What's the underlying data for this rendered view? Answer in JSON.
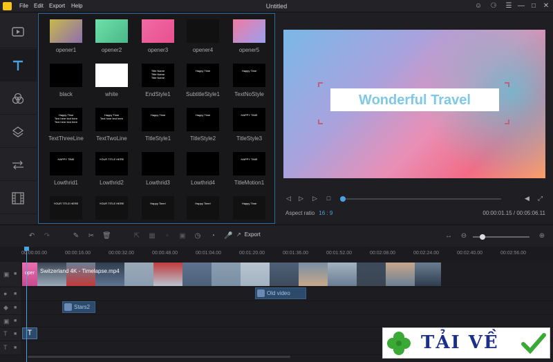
{
  "window": {
    "title": "Untitled",
    "menus": [
      "File",
      "Edit",
      "Export",
      "Help"
    ]
  },
  "nav": [
    "media-icon",
    "text-icon",
    "filter-icon",
    "overlay-icon",
    "transition-icon",
    "film-icon"
  ],
  "titles": [
    {
      "label": "opener1",
      "thumb_text": ""
    },
    {
      "label": "opener2",
      "thumb_text": ""
    },
    {
      "label": "opener3",
      "thumb_text": ""
    },
    {
      "label": "opener4",
      "thumb_text": ""
    },
    {
      "label": "opener5",
      "thumb_text": ""
    },
    {
      "label": "black",
      "thumb_text": ""
    },
    {
      "label": "white",
      "thumb_text": ""
    },
    {
      "label": "EndStyle1",
      "thumb_text": "Title Name\nTitle Name\nTitle Name"
    },
    {
      "label": "SubtitleStyle1",
      "thumb_text": "Happy Time"
    },
    {
      "label": "TextNoStyle",
      "thumb_text": "Happy Time"
    },
    {
      "label": "TextThreeLine",
      "thumb_text": "Happy Time\nText here text here\nText here text here"
    },
    {
      "label": "TextTwoLine",
      "thumb_text": "Happy Time\nText here text here"
    },
    {
      "label": "TitleStyle1",
      "thumb_text": "Happy Time"
    },
    {
      "label": "TitleStyle2",
      "thumb_text": "Happy Time"
    },
    {
      "label": "TitleStyle3",
      "thumb_text": "HAPPY TIME"
    },
    {
      "label": "Lowthrid1",
      "thumb_text": "HAPPY TIME"
    },
    {
      "label": "Lowthrid2",
      "thumb_text": "YOUR TITLE HERE"
    },
    {
      "label": "Lowthrid3",
      "thumb_text": ""
    },
    {
      "label": "Lowthrid4",
      "thumb_text": ""
    },
    {
      "label": "TitleMotion1",
      "thumb_text": "HAPPY TIME"
    },
    {
      "label": "",
      "thumb_text": "YOUR TITLE HERE"
    },
    {
      "label": "",
      "thumb_text": "YOUR TITLE HERE"
    },
    {
      "label": "",
      "thumb_text": "Happy Time!"
    },
    {
      "label": "",
      "thumb_text": "Happy Time!"
    },
    {
      "label": "",
      "thumb_text": "Happy Time"
    }
  ],
  "preview": {
    "title_text": "Wonderful Travel",
    "aspect_label": "Aspect ratio",
    "aspect_value": "16 : 9",
    "timecode": "00:00:01.15 / 00:05:06.11",
    "progress": 0.0
  },
  "toolbar": {
    "export_label": "Export",
    "zoom": 0.12
  },
  "ruler": [
    "00:00:00.00",
    "00:00:16.00",
    "00:00:32.00",
    "00:00:48.00",
    "00:01:04.00",
    "00:01:20.00",
    "00:01:36.00",
    "00:01:52.00",
    "00:02:08.00",
    "00:02:24.00",
    "00:02:40.00",
    "00:02:56.00"
  ],
  "timeline": {
    "opener_label": "oper",
    "video_label": "Switzerland 4K - Timelapse.mp4",
    "overlay_label": "Old video",
    "effect_label": "Stars2",
    "text_clip": "T"
  },
  "watermark": {
    "text": "TẢI VỀ"
  }
}
